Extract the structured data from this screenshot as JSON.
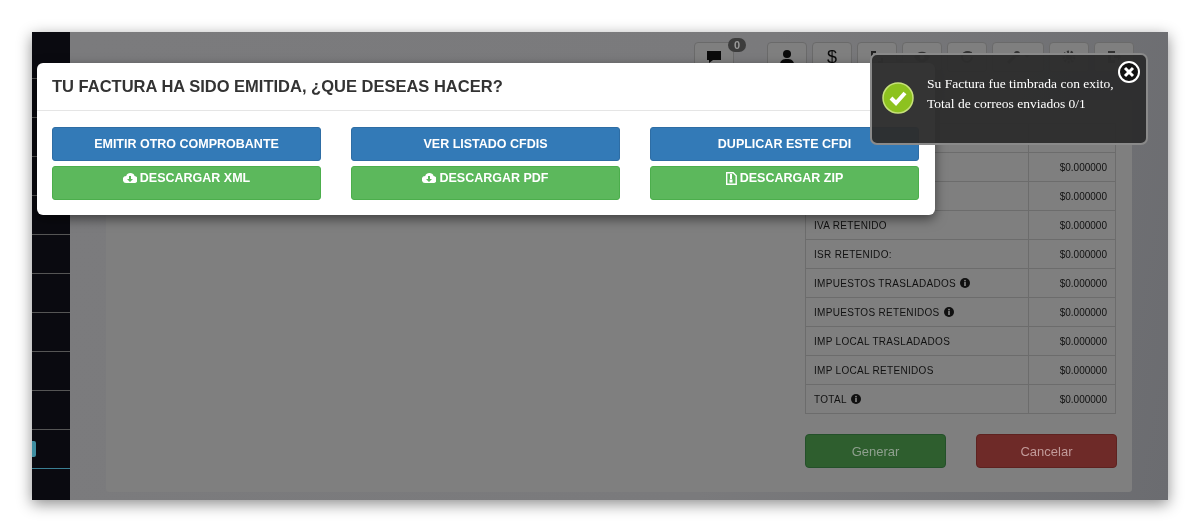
{
  "sidebar": {
    "items": [
      {
        "selected": false
      },
      {
        "selected": false
      },
      {
        "selected": false
      },
      {
        "selected": false
      },
      {
        "selected": false
      },
      {
        "selected": false
      },
      {
        "selected": false
      },
      {
        "selected": false
      },
      {
        "selected": false
      },
      {
        "selected": false
      },
      {
        "selected": true
      }
    ]
  },
  "toolbar": {
    "message_count": "0",
    "currency_symbol": "$"
  },
  "totals_table": {
    "rows": [
      {
        "value": "$0.000000"
      },
      {
        "value": "$0.000000"
      },
      {
        "label": "IVA RETENIDO",
        "info": false,
        "value": "$0.000000"
      },
      {
        "label": "ISR RETENIDO:",
        "info": false,
        "value": "$0.000000"
      },
      {
        "label": "IMPUESTOS TRASLADADOS",
        "info": true,
        "value": "$0.000000"
      },
      {
        "label": "IMPUESTOS RETENIDOS",
        "info": true,
        "value": "$0.000000"
      },
      {
        "label": "IMP LOCAL TRASLADADOS",
        "info": false,
        "value": "$0.000000"
      },
      {
        "label": "IMP LOCAL RETENIDOS",
        "info": false,
        "value": "$0.000000"
      },
      {
        "label": "TOTAL",
        "info": true,
        "value": "$0.000000"
      }
    ]
  },
  "form_buttons": [
    {
      "label": "Generar",
      "kind": "success"
    },
    {
      "label": "Cancelar",
      "kind": "danger"
    }
  ],
  "modal": {
    "title": "TU FACTURA HA SIDO EMITIDA, ¿QUE DESEAS HACER?",
    "actions": [
      {
        "label": "EMITIR OTRO COMPROBANTE",
        "kind": "primary"
      },
      {
        "label": "VER LISTADO CFDIS",
        "kind": "primary"
      },
      {
        "label": "DUPLICAR ESTE CFDI",
        "kind": "primary"
      },
      {
        "label": "DESCARGAR XML",
        "kind": "download"
      },
      {
        "label": "DESCARGAR PDF",
        "kind": "download"
      },
      {
        "label": "DESCARGAR ZIP",
        "kind": "download"
      }
    ]
  },
  "toast": {
    "lines": [
      "Su Factura fue timbrada con exito,",
      "Total de correos enviados 0/1"
    ]
  }
}
